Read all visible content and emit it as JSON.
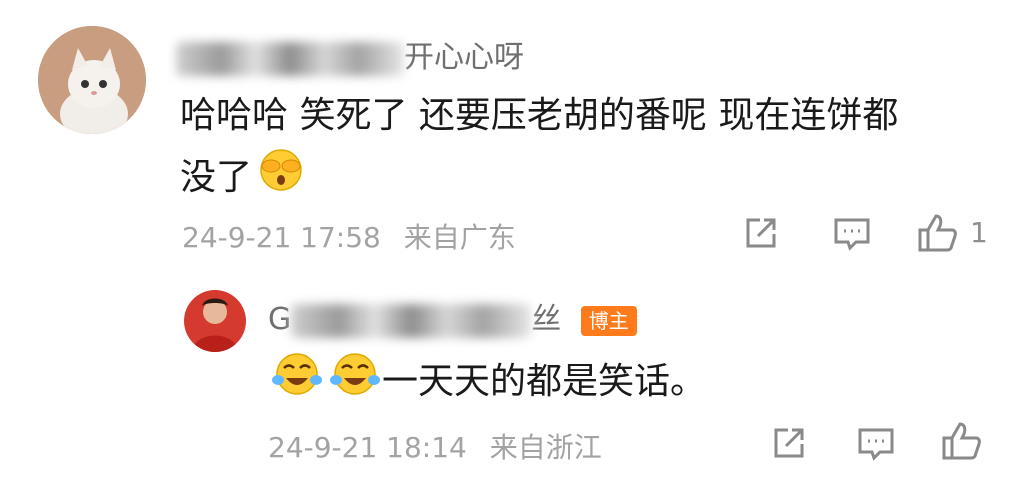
{
  "comment": {
    "username_suffix": "开心心呀",
    "content_line1": "哈哈哈 笑死了 还要压老胡的番呢 现在连饼都",
    "content_line2": "没了",
    "timestamp": "24-9-21 17:58",
    "location": "来自广东",
    "like_count": "1"
  },
  "reply": {
    "username_prefix": "G",
    "username_suffix": "丝",
    "badge": "博主",
    "content": "一天天的都是笑话。",
    "timestamp": "24-9-21 18:14",
    "location": "来自浙江"
  },
  "colors": {
    "badge": "#ff7a1a",
    "meta_text": "#a3a3a3",
    "emoji_yellow": "#ffcc33"
  }
}
